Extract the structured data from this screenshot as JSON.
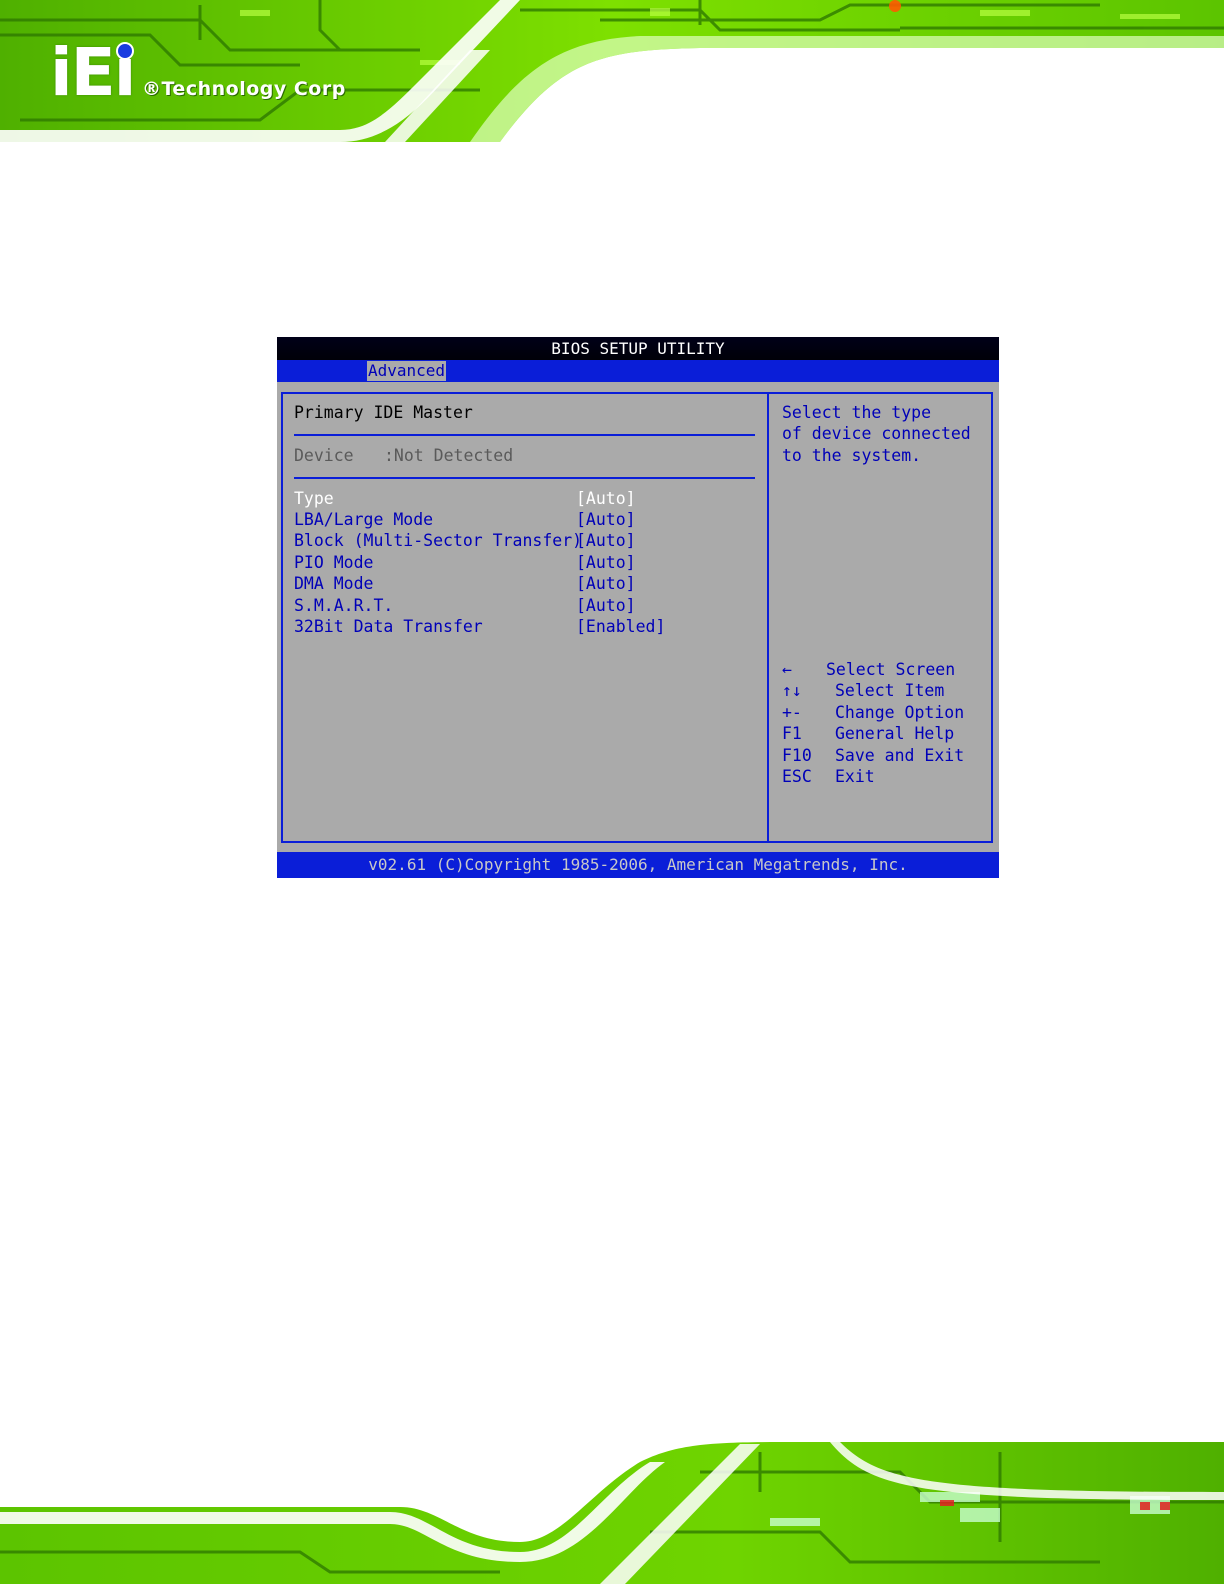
{
  "brand": {
    "logo_letters": "iEi",
    "tagline": "®Technology Corp"
  },
  "bios": {
    "title": "BIOS SETUP UTILITY",
    "active_tab": "Advanced",
    "section_title": "Primary IDE Master",
    "device": {
      "label": "Device",
      "value": ":Not Detected"
    },
    "settings": [
      {
        "label": "Type",
        "value": "[Auto]",
        "selected": true
      },
      {
        "label": "LBA/Large Mode",
        "value": "[Auto]",
        "selected": false
      },
      {
        "label": "Block (Multi-Sector Transfer)",
        "value": "[Auto]",
        "selected": false
      },
      {
        "label": "PIO Mode",
        "value": "[Auto]",
        "selected": false
      },
      {
        "label": "DMA Mode",
        "value": "[Auto]",
        "selected": false
      },
      {
        "label": "S.M.A.R.T.",
        "value": "[Auto]",
        "selected": false
      },
      {
        "label": "32Bit Data Transfer",
        "value": "[Enabled]",
        "selected": false
      }
    ],
    "help_text": [
      "Select the type",
      "of device connected",
      "to the system."
    ],
    "key_legend": [
      {
        "key": "←",
        "action": "Select Screen"
      },
      {
        "key": "↑↓",
        "action": "Select Item"
      },
      {
        "key": "+-",
        "action": "Change Option"
      },
      {
        "key": "F1",
        "action": "General Help"
      },
      {
        "key": "F10",
        "action": "Save and Exit"
      },
      {
        "key": "ESC",
        "action": "Exit"
      }
    ],
    "footer": "v02.61 (C)Copyright 1985-2006, American Megatrends, Inc."
  },
  "colors": {
    "bios_background": "#aaaaaa",
    "bios_blue": "#0a1ed8",
    "text_blue": "#0000b8",
    "banner_green": "#6fd400"
  }
}
